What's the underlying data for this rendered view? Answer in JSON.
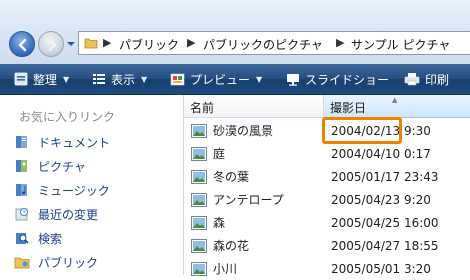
{
  "address": {
    "crumbs": [
      "パブリック",
      "パブリックのピクチャ",
      "サンプル ピクチャ"
    ],
    "separator": "▶"
  },
  "toolbar": {
    "items": [
      {
        "label": "整理",
        "icon": "organize-icon",
        "has_dropdown": true
      },
      {
        "label": "表示",
        "icon": "views-icon",
        "has_dropdown": true
      },
      {
        "label": "プレビュー",
        "icon": "preview-icon",
        "has_dropdown": true
      },
      {
        "label": "スライドショー",
        "icon": "slideshow-icon",
        "has_dropdown": false
      },
      {
        "label": "印刷",
        "icon": "print-icon",
        "has_dropdown": false
      }
    ]
  },
  "navpane": {
    "title": "お気に入りリンク",
    "links": [
      {
        "label": "ドキュメント",
        "icon": "documents-icon"
      },
      {
        "label": "ピクチャ",
        "icon": "pictures-icon"
      },
      {
        "label": "ミュージック",
        "icon": "music-icon"
      },
      {
        "label": "最近の変更",
        "icon": "recent-changes-icon"
      },
      {
        "label": "検索",
        "icon": "search-folder-icon"
      },
      {
        "label": "パブリック",
        "icon": "public-folder-icon"
      }
    ]
  },
  "filelist": {
    "columns": {
      "name": "名前",
      "date": "撮影日"
    },
    "sort_indicator": "▲",
    "files": [
      {
        "name": "砂漠の風景",
        "date": "2004/02/13 9:30"
      },
      {
        "name": "庭",
        "date": "2004/04/10 0:17"
      },
      {
        "name": "冬の葉",
        "date": "2005/01/17 23:43"
      },
      {
        "name": "アンテロープ",
        "date": "2005/04/23 9:20"
      },
      {
        "name": "森",
        "date": "2005/04/25 16:00"
      },
      {
        "name": "森の花",
        "date": "2005/04/27 18:55"
      },
      {
        "name": "小川",
        "date": "2005/05/01 3:20"
      }
    ]
  },
  "colors": {
    "highlight": "#f08200",
    "toolbar": "#244f80",
    "link_text": "#1f3f8f"
  }
}
